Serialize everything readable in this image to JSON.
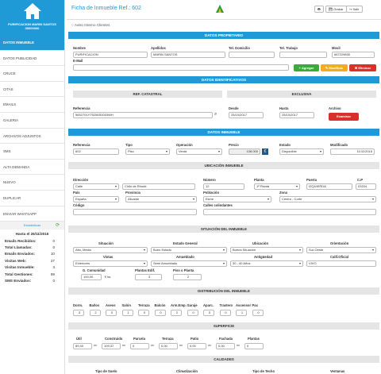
{
  "app": {
    "logo_text": "PURIFICACION MARIN SANTOS\n00000000",
    "title": "Ficha de Inmueble Ref.: 602",
    "print_label": "",
    "save_label": "Grabar",
    "exit_label": "Salir"
  },
  "sidebar": {
    "items": [
      "DATOS INMUEBLE",
      "DATOS PUBLICIDAD",
      "CRUCE",
      "CITAS",
      "EMAILS",
      "GALERIA",
      "ARCHIVOS ADJUNTOS",
      "SMS",
      "ALTA DEMANDA",
      "NUEVO",
      "DUPLICAR",
      "ENVIAR WHATSAPP"
    ]
  },
  "stats": {
    "header": "Estadisticas",
    "hasta": "Hasta el 26/11/2016",
    "rows": [
      {
        "label": "Emails Recibidos:",
        "value": "0"
      },
      {
        "label": "Total Llamadas:",
        "value": "0"
      },
      {
        "label": "Emails Enviados:",
        "value": "10"
      },
      {
        "label": "Visitas Web:",
        "value": "27"
      },
      {
        "label": "Visitas Inmueble:",
        "value": "3"
      },
      {
        "label": "Total Gestiones:",
        "value": "99"
      },
      {
        "label": "SMS Enviados:",
        "value": "0"
      }
    ]
  },
  "aviso": "Aviso Interno Clientes",
  "propietario": {
    "header": "DATOS PROPIETARIO",
    "nombre_l": "Nombre",
    "nombre": "PURIFICACION",
    "apellidos_l": "Apellidos",
    "apellidos": "MARIN SANTOS",
    "tel_dom_l": "Tel. Domicilio",
    "tel_trab_l": "Tel. Trabajo",
    "movil_l": "Movil",
    "movil": "667229830",
    "email_l": "E-Mail",
    "agregar": "+ Agregar",
    "modificar": "✎ Modificar",
    "eliminar": "✖ Eliminar"
  },
  "identificativos": {
    "header": "DATOS IDENTIFICATIVOS",
    "catastral": "REF. CATASTRAL",
    "exclusiva": "EXCLUSIVA",
    "referencia_l": "Referencia",
    "referencia": "5652701YT5256S0003WH",
    "desde_l": "Desde",
    "desde": "25/10/2017",
    "hasta_l": "Hasta",
    "hasta": "25/10/2017",
    "archivo_l": "Archivo",
    "examinar": "Examinar"
  },
  "inmueble": {
    "header": "DATOS INMUEBLE",
    "referencia_l": "Referencia",
    "referencia": "602",
    "tipo_l": "Tipo",
    "tipo": "Piso",
    "operacion_l": "Operación",
    "operacion": "Venta",
    "precio_l": "Precio",
    "precio": "108.000",
    "estado_l": "Estado",
    "estado": "Disponible",
    "modificado_l": "Modificado",
    "modificado": "11/11/2016"
  },
  "ubicacion": {
    "header": "UBICACIÓN INMUEBLE",
    "direccion_l": "Dirección",
    "tipo_via": "Calle",
    "via": "Cirilo de Rhode",
    "numero_l": "Número",
    "numero": "12",
    "planta_l": "Planta",
    "planta": "1ª Planta",
    "puerta_l": "Puerta",
    "puerta": "IZQUIERDA",
    "cp_l": "C.P",
    "cp": "03204",
    "pais_l": "País",
    "pais": "España",
    "provincia_l": "Provincia",
    "provincia": "Alicante",
    "poblacion_l": "Población",
    "poblacion": "Elche",
    "zona_l": "Zona",
    "zona": "Centro - Corte",
    "codigo_l": "Código",
    "calles_l": "Calles colindantes"
  },
  "situacion": {
    "header": "SITUACIÓN DEL INMUEBLE",
    "situacion_l": "Situación",
    "situacion": "Alto, Medio",
    "estado_l": "Estado General",
    "estado": "Buen Estado",
    "ubicacion_l": "Ubicación",
    "ubicacion": "Buena Situación",
    "orientacion_l": "Orientación",
    "orientacion": "Sur-Oeste",
    "vistas_l": "Vistas",
    "vistas": "Exteriores",
    "amueblado_l": "Amueblado",
    "amueblado": "Semi Amueblado",
    "antiguedad_l": "Antigüedad",
    "antiguedad": "30 - 40 Años",
    "calif_l": "Calif.Oficial",
    "calif": "VIVO",
    "comunidad_l": "G. Comunidad",
    "comunidad": "100,00",
    "inc": "€ Inc.",
    "plantas_l": "Plantas Edif.",
    "plantas": "3",
    "piso_l": "Piso o Planta",
    "piso": "2"
  },
  "distribucion": {
    "header": "DISTRIBUCIÓN DEL INMUEBLE",
    "items": [
      {
        "l": "Dorm.",
        "v": "3"
      },
      {
        "l": "Baños",
        "v": "2"
      },
      {
        "l": "Aseos",
        "v": "0"
      },
      {
        "l": "Salón",
        "v": "1"
      },
      {
        "l": "Terraza",
        "v": "0"
      },
      {
        "l": "Balcón",
        "v": "0"
      },
      {
        "l": "Arm.Emp.",
        "v": "2"
      },
      {
        "l": "Garaje",
        "v": "0"
      },
      {
        "l": "Aparc.",
        "v": "0"
      },
      {
        "l": "Trastero",
        "v": "0"
      },
      {
        "l": "Ascensor",
        "v": "1"
      },
      {
        "l": "Pax",
        "v": "0"
      }
    ]
  },
  "superficie": {
    "header": "SUPERFICIE",
    "items": [
      {
        "l": "Útil",
        "v": "89,40",
        "u": "m²"
      },
      {
        "l": "Construido",
        "v": "109,37",
        "u": "m²"
      },
      {
        "l": "Parcela",
        "v": "0",
        "u": "m²"
      },
      {
        "l": "Terraza",
        "v": "0,00",
        "u": "m²"
      },
      {
        "l": "Patio",
        "v": "0,00",
        "u": "m²"
      },
      {
        "l": "Fachada",
        "v": "0,00",
        "u": "m²"
      },
      {
        "l": "Plantas",
        "v": "0",
        "u": ""
      }
    ]
  },
  "calidades": {
    "header": "CALIDADES",
    "suelo": "Tipo de Suelo",
    "climatizacion": "Climatización",
    "techo": "Tipo de Techo",
    "ventanas": "Ventanas"
  }
}
